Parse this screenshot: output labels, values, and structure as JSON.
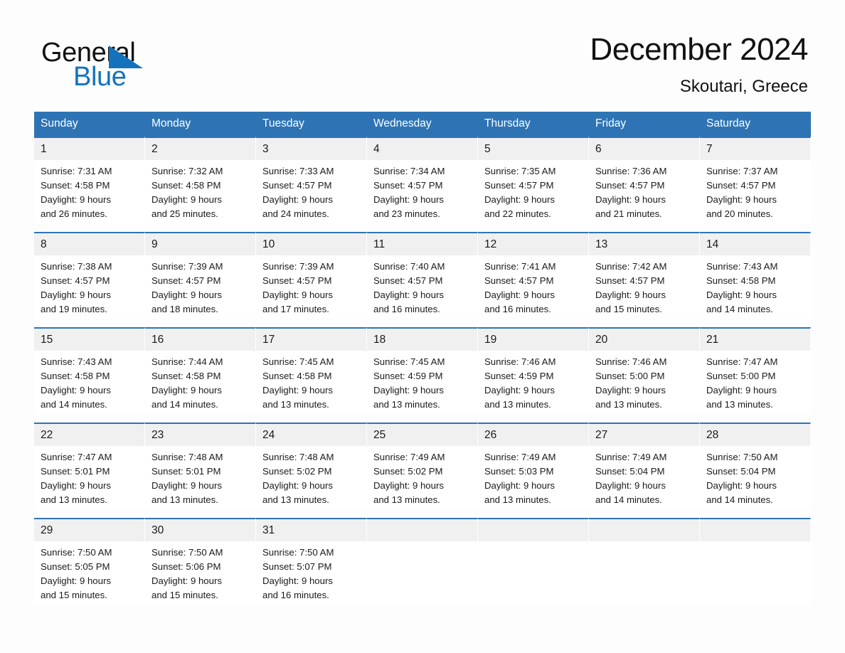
{
  "brand": {
    "name_part1": "General",
    "name_part2": "Blue",
    "logo_icon": "triangle-icon",
    "accent_color": "#1472bd"
  },
  "header": {
    "title": "December 2024",
    "subtitle": "Skoutari, Greece",
    "header_bg_color": "#2e74b5",
    "daynum_bg_color": "#f0f0f0"
  },
  "weekday_headers": [
    "Sunday",
    "Monday",
    "Tuesday",
    "Wednesday",
    "Thursday",
    "Friday",
    "Saturday"
  ],
  "weeks": [
    [
      {
        "day": "1",
        "sunrise": "Sunrise: 7:31 AM",
        "sunset": "Sunset: 4:58 PM",
        "daylight_line1": "Daylight: 9 hours",
        "daylight_line2": "and 26 minutes."
      },
      {
        "day": "2",
        "sunrise": "Sunrise: 7:32 AM",
        "sunset": "Sunset: 4:58 PM",
        "daylight_line1": "Daylight: 9 hours",
        "daylight_line2": "and 25 minutes."
      },
      {
        "day": "3",
        "sunrise": "Sunrise: 7:33 AM",
        "sunset": "Sunset: 4:57 PM",
        "daylight_line1": "Daylight: 9 hours",
        "daylight_line2": "and 24 minutes."
      },
      {
        "day": "4",
        "sunrise": "Sunrise: 7:34 AM",
        "sunset": "Sunset: 4:57 PM",
        "daylight_line1": "Daylight: 9 hours",
        "daylight_line2": "and 23 minutes."
      },
      {
        "day": "5",
        "sunrise": "Sunrise: 7:35 AM",
        "sunset": "Sunset: 4:57 PM",
        "daylight_line1": "Daylight: 9 hours",
        "daylight_line2": "and 22 minutes."
      },
      {
        "day": "6",
        "sunrise": "Sunrise: 7:36 AM",
        "sunset": "Sunset: 4:57 PM",
        "daylight_line1": "Daylight: 9 hours",
        "daylight_line2": "and 21 minutes."
      },
      {
        "day": "7",
        "sunrise": "Sunrise: 7:37 AM",
        "sunset": "Sunset: 4:57 PM",
        "daylight_line1": "Daylight: 9 hours",
        "daylight_line2": "and 20 minutes."
      }
    ],
    [
      {
        "day": "8",
        "sunrise": "Sunrise: 7:38 AM",
        "sunset": "Sunset: 4:57 PM",
        "daylight_line1": "Daylight: 9 hours",
        "daylight_line2": "and 19 minutes."
      },
      {
        "day": "9",
        "sunrise": "Sunrise: 7:39 AM",
        "sunset": "Sunset: 4:57 PM",
        "daylight_line1": "Daylight: 9 hours",
        "daylight_line2": "and 18 minutes."
      },
      {
        "day": "10",
        "sunrise": "Sunrise: 7:39 AM",
        "sunset": "Sunset: 4:57 PM",
        "daylight_line1": "Daylight: 9 hours",
        "daylight_line2": "and 17 minutes."
      },
      {
        "day": "11",
        "sunrise": "Sunrise: 7:40 AM",
        "sunset": "Sunset: 4:57 PM",
        "daylight_line1": "Daylight: 9 hours",
        "daylight_line2": "and 16 minutes."
      },
      {
        "day": "12",
        "sunrise": "Sunrise: 7:41 AM",
        "sunset": "Sunset: 4:57 PM",
        "daylight_line1": "Daylight: 9 hours",
        "daylight_line2": "and 16 minutes."
      },
      {
        "day": "13",
        "sunrise": "Sunrise: 7:42 AM",
        "sunset": "Sunset: 4:57 PM",
        "daylight_line1": "Daylight: 9 hours",
        "daylight_line2": "and 15 minutes."
      },
      {
        "day": "14",
        "sunrise": "Sunrise: 7:43 AM",
        "sunset": "Sunset: 4:58 PM",
        "daylight_line1": "Daylight: 9 hours",
        "daylight_line2": "and 14 minutes."
      }
    ],
    [
      {
        "day": "15",
        "sunrise": "Sunrise: 7:43 AM",
        "sunset": "Sunset: 4:58 PM",
        "daylight_line1": "Daylight: 9 hours",
        "daylight_line2": "and 14 minutes."
      },
      {
        "day": "16",
        "sunrise": "Sunrise: 7:44 AM",
        "sunset": "Sunset: 4:58 PM",
        "daylight_line1": "Daylight: 9 hours",
        "daylight_line2": "and 14 minutes."
      },
      {
        "day": "17",
        "sunrise": "Sunrise: 7:45 AM",
        "sunset": "Sunset: 4:58 PM",
        "daylight_line1": "Daylight: 9 hours",
        "daylight_line2": "and 13 minutes."
      },
      {
        "day": "18",
        "sunrise": "Sunrise: 7:45 AM",
        "sunset": "Sunset: 4:59 PM",
        "daylight_line1": "Daylight: 9 hours",
        "daylight_line2": "and 13 minutes."
      },
      {
        "day": "19",
        "sunrise": "Sunrise: 7:46 AM",
        "sunset": "Sunset: 4:59 PM",
        "daylight_line1": "Daylight: 9 hours",
        "daylight_line2": "and 13 minutes."
      },
      {
        "day": "20",
        "sunrise": "Sunrise: 7:46 AM",
        "sunset": "Sunset: 5:00 PM",
        "daylight_line1": "Daylight: 9 hours",
        "daylight_line2": "and 13 minutes."
      },
      {
        "day": "21",
        "sunrise": "Sunrise: 7:47 AM",
        "sunset": "Sunset: 5:00 PM",
        "daylight_line1": "Daylight: 9 hours",
        "daylight_line2": "and 13 minutes."
      }
    ],
    [
      {
        "day": "22",
        "sunrise": "Sunrise: 7:47 AM",
        "sunset": "Sunset: 5:01 PM",
        "daylight_line1": "Daylight: 9 hours",
        "daylight_line2": "and 13 minutes."
      },
      {
        "day": "23",
        "sunrise": "Sunrise: 7:48 AM",
        "sunset": "Sunset: 5:01 PM",
        "daylight_line1": "Daylight: 9 hours",
        "daylight_line2": "and 13 minutes."
      },
      {
        "day": "24",
        "sunrise": "Sunrise: 7:48 AM",
        "sunset": "Sunset: 5:02 PM",
        "daylight_line1": "Daylight: 9 hours",
        "daylight_line2": "and 13 minutes."
      },
      {
        "day": "25",
        "sunrise": "Sunrise: 7:49 AM",
        "sunset": "Sunset: 5:02 PM",
        "daylight_line1": "Daylight: 9 hours",
        "daylight_line2": "and 13 minutes."
      },
      {
        "day": "26",
        "sunrise": "Sunrise: 7:49 AM",
        "sunset": "Sunset: 5:03 PM",
        "daylight_line1": "Daylight: 9 hours",
        "daylight_line2": "and 13 minutes."
      },
      {
        "day": "27",
        "sunrise": "Sunrise: 7:49 AM",
        "sunset": "Sunset: 5:04 PM",
        "daylight_line1": "Daylight: 9 hours",
        "daylight_line2": "and 14 minutes."
      },
      {
        "day": "28",
        "sunrise": "Sunrise: 7:50 AM",
        "sunset": "Sunset: 5:04 PM",
        "daylight_line1": "Daylight: 9 hours",
        "daylight_line2": "and 14 minutes."
      }
    ],
    [
      {
        "day": "29",
        "sunrise": "Sunrise: 7:50 AM",
        "sunset": "Sunset: 5:05 PM",
        "daylight_line1": "Daylight: 9 hours",
        "daylight_line2": "and 15 minutes."
      },
      {
        "day": "30",
        "sunrise": "Sunrise: 7:50 AM",
        "sunset": "Sunset: 5:06 PM",
        "daylight_line1": "Daylight: 9 hours",
        "daylight_line2": "and 15 minutes."
      },
      {
        "day": "31",
        "sunrise": "Sunrise: 7:50 AM",
        "sunset": "Sunset: 5:07 PM",
        "daylight_line1": "Daylight: 9 hours",
        "daylight_line2": "and 16 minutes."
      },
      {
        "day": "",
        "sunrise": "",
        "sunset": "",
        "daylight_line1": "",
        "daylight_line2": ""
      },
      {
        "day": "",
        "sunrise": "",
        "sunset": "",
        "daylight_line1": "",
        "daylight_line2": ""
      },
      {
        "day": "",
        "sunrise": "",
        "sunset": "",
        "daylight_line1": "",
        "daylight_line2": ""
      },
      {
        "day": "",
        "sunrise": "",
        "sunset": "",
        "daylight_line1": "",
        "daylight_line2": ""
      }
    ]
  ]
}
